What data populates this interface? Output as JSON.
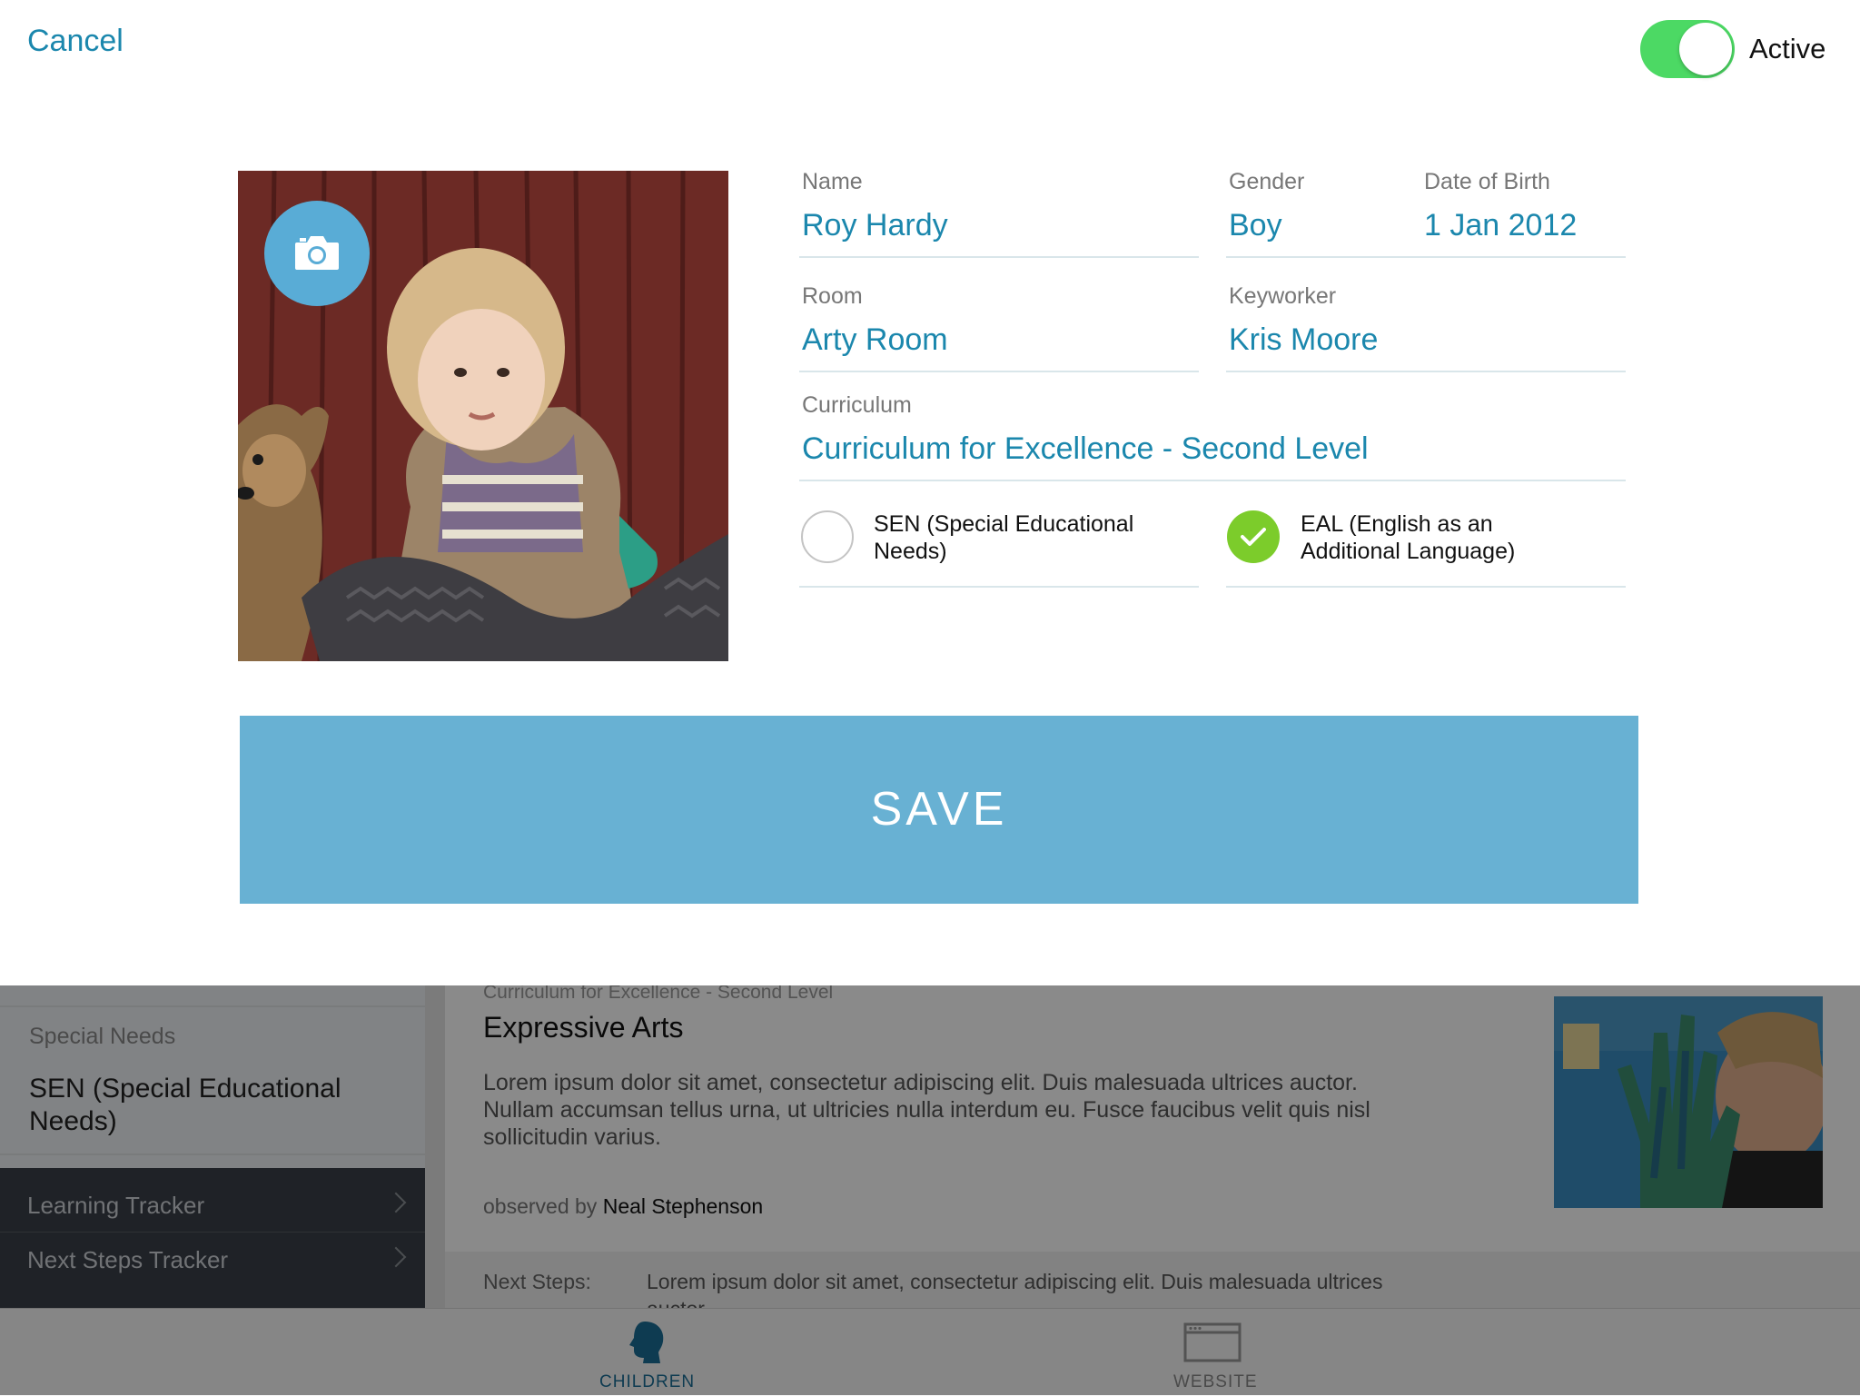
{
  "modal": {
    "cancel_label": "Cancel",
    "active_label": "Active",
    "active_on": true,
    "fields": {
      "name": {
        "label": "Name",
        "value": "Roy Hardy"
      },
      "gender": {
        "label": "Gender",
        "value": "Boy"
      },
      "dob": {
        "label": "Date of Birth",
        "value": "1 Jan 2012"
      },
      "room": {
        "label": "Room",
        "value": "Arty Room"
      },
      "keyworker": {
        "label": "Keyworker",
        "value": "Kris Moore"
      },
      "curriculum": {
        "label": "Curriculum",
        "value": "Curriculum for Excellence - Second Level"
      }
    },
    "sen": {
      "line1": "SEN (Special Educational",
      "line2": "Needs)",
      "checked": false
    },
    "eal": {
      "line1": "EAL (English as an",
      "line2": "Additional Language)",
      "checked": true
    },
    "save_label": "SAVE",
    "camera_icon": "camera-icon"
  },
  "background": {
    "sidebar": {
      "special_needs_label": "Special Needs",
      "special_needs_line1": "SEN (Special Educational",
      "special_needs_line2": "Needs)",
      "nav": [
        {
          "label": "Learning Tracker"
        },
        {
          "label": "Next Steps Tracker"
        }
      ]
    },
    "observation": {
      "curriculum": "Curriculum for Excellence - Second Level",
      "title": "Expressive Arts",
      "body_line1": "Lorem ipsum dolor sit amet, consectetur adipiscing elit. Duis malesuada ultrices auctor.",
      "body_line2": "Nullam accumsan tellus urna, ut ultricies nulla interdum eu. Fusce faucibus velit quis nisl",
      "body_line3": "sollicitudin varius.",
      "observed_by_prefix": "observed by",
      "observer": "Neal Stephenson",
      "next_steps_label": "Next Steps:",
      "next_steps_text": "Lorem ipsum dolor sit amet, consectetur adipiscing elit. Duis malesuada ultrices",
      "next_steps_text_cut": "auctor."
    },
    "tabs": [
      {
        "label": "CHILDREN",
        "icon": "child-head-icon",
        "selected": true
      },
      {
        "label": "WEBSITE",
        "icon": "browser-window-icon",
        "selected": false
      }
    ]
  },
  "colors": {
    "accent": "#1b87ad",
    "save_button": "#68b1d3",
    "toggle_on": "#4cd964",
    "check_green": "#7ccc2b"
  }
}
